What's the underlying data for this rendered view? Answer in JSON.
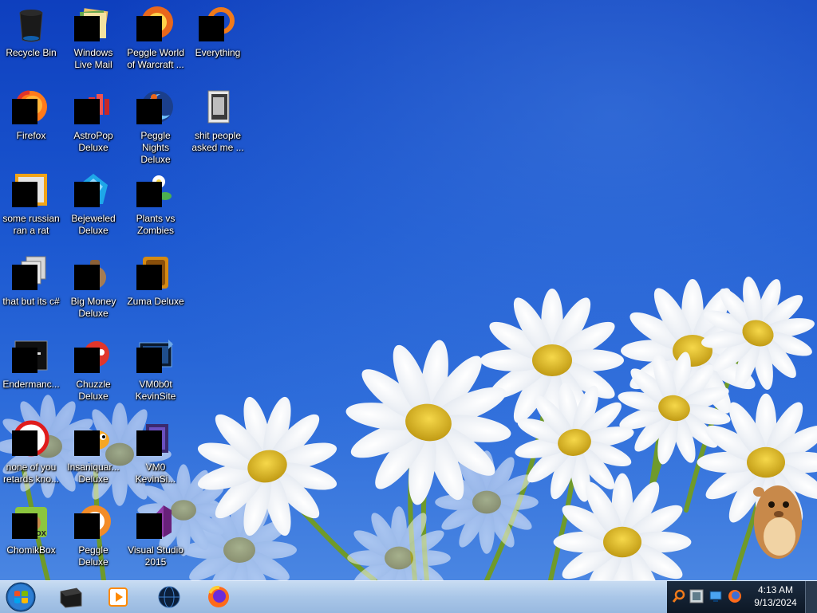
{
  "desktop": {
    "icons": [
      {
        "label": "Recycle Bin",
        "icon": "recycle-bin-icon"
      },
      {
        "label": "Windows Live Mail",
        "icon": "mail-icon"
      },
      {
        "label": "Peggle World of Warcraft ...",
        "icon": "peggle-icon"
      },
      {
        "label": "Everything",
        "icon": "search-app-icon"
      },
      {
        "label": "Firefox",
        "icon": "firefox-icon"
      },
      {
        "label": "AstroPop Deluxe",
        "icon": "astropop-icon"
      },
      {
        "label": "Peggle Nights Deluxe",
        "icon": "peggle-nights-icon"
      },
      {
        "label": "shit people asked me ...",
        "icon": "folder-icon"
      },
      {
        "label": "some russian ran a rat",
        "icon": "java-icon"
      },
      {
        "label": "Bejeweled Deluxe",
        "icon": "bejeweled-icon"
      },
      {
        "label": "Plants vs Zombies",
        "icon": "plants-vs-zombies-icon"
      },
      {
        "label": "that but its c#",
        "icon": "documents-icon"
      },
      {
        "label": "Big Money Deluxe",
        "icon": "money-bag-icon"
      },
      {
        "label": "Zuma Deluxe",
        "icon": "zuma-icon"
      },
      {
        "label": "Endermanc...",
        "icon": "app-window-icon"
      },
      {
        "label": "Chuzzle Deluxe",
        "icon": "chuzzle-icon"
      },
      {
        "label": "VM0b0t KevinSite",
        "icon": "vm-icon"
      },
      {
        "label": "none of you retards kno...",
        "icon": "circle-app-icon"
      },
      {
        "label": "Insaniquar... Deluxe",
        "icon": "fish-icon"
      },
      {
        "label": "VM0 KevinSi...",
        "icon": "vm-shortcut-icon"
      },
      {
        "label": "ChomikBox",
        "icon": "chomikbox-icon"
      },
      {
        "label": "Peggle Deluxe",
        "icon": "peggle-deluxe-icon"
      },
      {
        "label": "Visual Studio 2015",
        "icon": "visual-studio-icon"
      }
    ]
  },
  "taskbar": {
    "start": {
      "icon": "windows-logo-icon"
    },
    "pinned": [
      {
        "name": "taskbar-app-terminal",
        "icon": "black-box-icon"
      },
      {
        "name": "taskbar-app-media-player",
        "icon": "media-player-icon"
      },
      {
        "name": "taskbar-app-globe",
        "icon": "globe-icon"
      },
      {
        "name": "taskbar-app-firefox",
        "icon": "firefox-icon"
      }
    ],
    "tray": {
      "icons": [
        "search-tray-icon",
        "network-tray-icon",
        "display-tray-icon",
        "firefox-tray-icon"
      ],
      "time": "4:13 AM",
      "date": "9/13/2024"
    }
  },
  "colors": {
    "sky_top": "#0e3fbe",
    "sky_bottom": "#4a86e2",
    "taskbar": "#a9c6e8",
    "tray": "#1b2b3f"
  }
}
